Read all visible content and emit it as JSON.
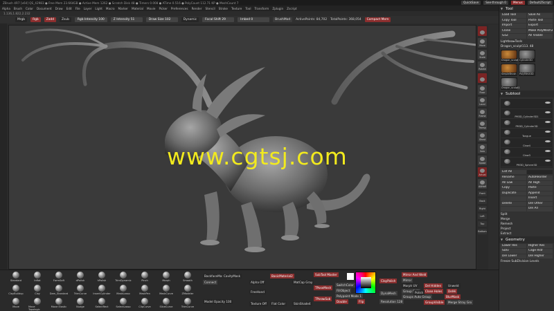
{
  "titlebar": {
    "left": "ZBrush 4R7 [x64]   QS_42983   ● Free Mem 23.664GB ● Active Mem 1262 ● Scratch Disk 48 ● Timers 0.008 ● ATime 0.516 ● PolyCount 112.71 KP ● MeshCount 7",
    "quicksave": "QuickSave",
    "seethrough": "See-through 0",
    "menus": "Menus",
    "script": "DefaultZScript"
  },
  "menubar": [
    "Alpha",
    "Brush",
    "Color",
    "Document",
    "Draw",
    "Edit",
    "File",
    "Layer",
    "Light",
    "Macro",
    "Marker",
    "Material",
    "Movie",
    "Picker",
    "Preferences",
    "Render",
    "Stencil",
    "Stroke",
    "Texture",
    "Tool",
    "Transform",
    "Zplugin",
    "Zscript"
  ],
  "coords": "1.136,1.822,2.232",
  "shelf": {
    "mrgb": "Mrgb",
    "rgb": "Rgb",
    "zadd": "Zadd",
    "zsub": "Zsub",
    "rgb_intensity": "Rgb Intensity 100",
    "z_intensity": "Z Intensity 51",
    "draw_size": "Draw Size 102",
    "dynamic": "Dynamic",
    "focal_shift": "Focal Shift 29",
    "imbed": "Imbed 0",
    "brushmod": "BrushMod",
    "active_points": "ActivePoints: 84,702",
    "total_points": "TotalPoints: 368,054",
    "compact_mem": "Compact Mem"
  },
  "watermark": "www.cgtsj.com",
  "nav": [
    {
      "label": "",
      "red": true
    },
    {
      "label": "Move",
      "red": false
    },
    {
      "label": "Scale",
      "red": false
    },
    {
      "label": "Rotate",
      "red": false
    },
    {
      "label": "",
      "red": true
    },
    {
      "label": "Floor",
      "red": false
    },
    {
      "label": "Local",
      "red": false
    },
    {
      "label": "Frame",
      "red": false
    },
    {
      "label": "Transp",
      "red": false
    },
    {
      "label": "Ghost",
      "red": false
    },
    {
      "label": "Solo",
      "red": false
    },
    {
      "label": "Xpose",
      "red": false
    },
    {
      "label": "Actual",
      "red": true
    },
    {
      "label": "AAHalf",
      "red": false
    }
  ],
  "navsmall": [
    "Front",
    "Back",
    "Right",
    "Left",
    "Top",
    "Bottom"
  ],
  "panel": {
    "title": "Tool",
    "buttons": [
      {
        "label": "Load Tool",
        "red": false
      },
      {
        "label": "Save As",
        "red": false
      },
      {
        "label": "Copy Tool",
        "red": false
      },
      {
        "label": "Paste Tool",
        "red": false
      },
      {
        "label": "Import",
        "red": false
      },
      {
        "label": "Export",
        "red": false
      },
      {
        "label": "Clone",
        "red": false
      },
      {
        "label": "Make PolyMesh3D",
        "red": false
      },
      {
        "label": "GoZ",
        "red": false
      },
      {
        "label": "All  Visible",
        "red": false
      }
    ],
    "lightbox": "Lightbox▸Tools",
    "current": "Dragon_sculpt113. 48",
    "thumbs": [
      {
        "label": "Dragon_sculpt1",
        "sel": true
      },
      {
        "label": "Cylinder3D",
        "sel": false
      },
      {
        "label": "SimpleBrush",
        "sel": true
      },
      {
        "label": "PolyMesh3D",
        "sel": false
      },
      {
        "label": "Dragon_sculpt1",
        "sel": false
      }
    ],
    "subtool_title": "Subtool",
    "subtools": [
      "",
      "PM3D_Cylinder3D1",
      "PM3D_Cylinder3D",
      "Tongue",
      "Claw4",
      "Claw3",
      "PM3D_Sphere3D"
    ],
    "list_all": "List All",
    "actions": [
      {
        "label": "Rename",
        "red": false
      },
      {
        "label": "AutoReorder",
        "red": false
      },
      {
        "label": "All Low",
        "red": false
      },
      {
        "label": "All High",
        "red": false
      },
      {
        "label": "Copy",
        "red": false
      },
      {
        "label": "Paste",
        "red": false
      },
      {
        "label": "Duplicate",
        "red": false
      },
      {
        "label": "Append",
        "red": false
      },
      {
        "label": "",
        "red": false
      },
      {
        "label": "Insert",
        "red": false
      },
      {
        "label": "Delete",
        "red": false
      },
      {
        "label": "Del Other",
        "red": false
      },
      {
        "label": "",
        "red": false
      },
      {
        "label": "Del All",
        "red": false
      }
    ],
    "menu_items": [
      "Split",
      "Merge",
      "Remesh",
      "Project",
      "Extract"
    ],
    "geometry_title": "Geometry",
    "geometry": [
      {
        "label": "Lower Res",
        "red": false
      },
      {
        "label": "Higher Res",
        "red": false
      },
      {
        "label": "SDiv",
        "red": false
      },
      {
        "label": "Cage  Rstr",
        "red": false
      },
      {
        "label": "Del Lower",
        "red": false
      },
      {
        "label": "Del Higher",
        "red": false
      }
    ],
    "freeze": "Freeze SubDivision Levels"
  },
  "brushes": [
    {
      "label": "Standard"
    },
    {
      "label": "Inflat"
    },
    {
      "label": "FormSoft"
    },
    {
      "label": "dPolish"
    },
    {
      "label": "hPolish"
    },
    {
      "label": "TrimDynamic"
    },
    {
      "label": "Pinch"
    },
    {
      "label": "Morph"
    },
    {
      "label": "Smooth"
    },
    {
      "label": "ClayBuildup"
    },
    {
      "label": "Clay"
    },
    {
      "label": "Dam_Standard"
    },
    {
      "label": "TrimCurve"
    },
    {
      "label": "InsertCylinder"
    },
    {
      "label": "MaskLasso"
    },
    {
      "label": "MaskPen"
    },
    {
      "label": "MaskCurve"
    },
    {
      "label": "ZModeler"
    },
    {
      "label": "Move"
    },
    {
      "label": "Move Topologic"
    },
    {
      "label": "Move Elastic"
    },
    {
      "label": "Nudge"
    },
    {
      "label": "SelectRect"
    },
    {
      "label": "SelectLasso"
    },
    {
      "label": "ClipCurve"
    },
    {
      "label": "SliceCurve"
    },
    {
      "label": "TrimCurve"
    }
  ],
  "bottom": {
    "backface": "BackfaceMa: CavityMask",
    "model_opacity": "Model Opacity 100",
    "connect": "Connect",
    "alpha_off": "Alpha Off",
    "freehand": "FreeHand",
    "texture_off": "Texture Off",
    "basic_mat": "BasicMaterial2",
    "matcap_gray": "MatCap Gray",
    "flat_color": "Flat Color",
    "skin_shade": "SkinShade4",
    "subtool_master": "SubTool Master",
    "tposemesh": "TPoseMesh",
    "tposeasub": "TPose▸Sub",
    "switchcolor": "SwitchColor",
    "fillobject": "FillObject",
    "polypaint_mode": "Polypaint Mode 1",
    "double": "Double",
    "flip": "Flip",
    "claypolish": "ClayPolish",
    "dynamesh": "DynaMesh",
    "resolution": "Resolution 128",
    "mirror_weld": "Mirror And Weld",
    "mirror": "Mirror",
    "morph_uv": "Morph UV",
    "group_split": "Group Split",
    "groups_auto": "Groups Auto Group",
    "group_visible": "GroupVisible",
    "del_hidden": "Del Hidden",
    "close_holes": "Close Holes",
    "blur_mask": "BlurMask",
    "merge_stray": "Merge Stray Gro",
    "unweld": "Unweld",
    "delhi": "DelHi",
    "polish": "Polish"
  },
  "colors": {
    "accent_red": "#8c2e2e",
    "background": "#2b2b2b",
    "canvas": "#3a3a3a",
    "watermark": "#f2ea1e"
  }
}
